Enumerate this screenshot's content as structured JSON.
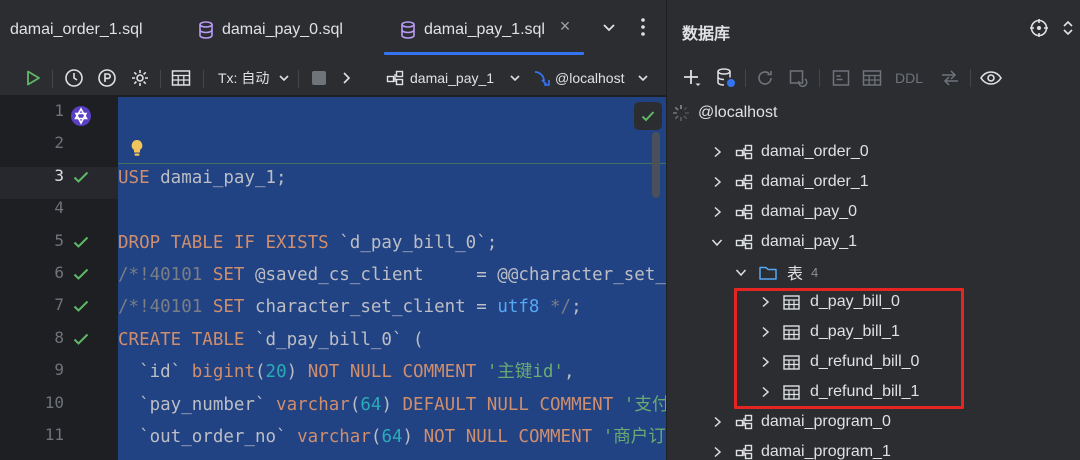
{
  "editor": {
    "tabs": [
      {
        "label": "damai_order_1.sql",
        "active": false
      },
      {
        "label": "damai_pay_0.sql",
        "active": false
      },
      {
        "label": "damai_pay_1.sql",
        "active": true
      }
    ],
    "toolbar": {
      "tx_label": "Tx: 自动",
      "schema_label": "damai_pay_1",
      "host_label": "@localhost"
    },
    "line_numbers": [
      "1",
      "2",
      "3",
      "4",
      "5",
      "6",
      "7",
      "8",
      "9",
      "10",
      "11"
    ],
    "lines": [
      {
        "n": 1,
        "parts": []
      },
      {
        "n": 2,
        "parts": []
      },
      {
        "n": 3,
        "parts": [
          [
            "kw",
            "USE"
          ],
          [
            "plain",
            " damai_pay_1;"
          ]
        ]
      },
      {
        "n": 4,
        "parts": []
      },
      {
        "n": 5,
        "parts": [
          [
            "kw",
            "DROP TABLE IF EXISTS"
          ],
          [
            "plain",
            " `d_pay_bill_0`;"
          ]
        ]
      },
      {
        "n": 6,
        "parts": [
          [
            "cmt",
            "/*!40101 "
          ],
          [
            "kw",
            "SET"
          ],
          [
            "plain",
            " @saved_cs_client     = @@character_set_client */;"
          ]
        ]
      },
      {
        "n": 7,
        "parts": [
          [
            "cmt",
            "/*!40101 "
          ],
          [
            "kw",
            "SET"
          ],
          [
            "plain",
            " character_set_client = "
          ],
          [
            "fn",
            "utf8"
          ],
          [
            "cmt",
            " */"
          ],
          [
            "plain",
            ";"
          ]
        ]
      },
      {
        "n": 8,
        "parts": [
          [
            "kw",
            "CREATE TABLE"
          ],
          [
            "plain",
            " `d_pay_bill_0` ("
          ]
        ]
      },
      {
        "n": 9,
        "parts": [
          [
            "plain",
            "  `id` "
          ],
          [
            "kw",
            "bigint"
          ],
          [
            "plain",
            "("
          ],
          [
            "num",
            "20"
          ],
          [
            "plain",
            ") "
          ],
          [
            "kw",
            "NOT NULL COMMENT"
          ],
          [
            "plain",
            " "
          ],
          [
            "str",
            "'主键id'"
          ],
          [
            "plain",
            ","
          ]
        ]
      },
      {
        "n": 10,
        "parts": [
          [
            "plain",
            "  `pay_number` "
          ],
          [
            "kw",
            "varchar"
          ],
          [
            "plain",
            "("
          ],
          [
            "num",
            "64"
          ],
          [
            "plain",
            ") "
          ],
          [
            "kw",
            "DEFAULT NULL COMMENT"
          ],
          [
            "plain",
            " "
          ],
          [
            "str",
            "'支付单号'"
          ]
        ]
      },
      {
        "n": 11,
        "parts": [
          [
            "plain",
            "  `out_order_no` "
          ],
          [
            "kw",
            "varchar"
          ],
          [
            "plain",
            "("
          ],
          [
            "num",
            "64"
          ],
          [
            "plain",
            ") "
          ],
          [
            "kw",
            "NOT NULL COMMENT"
          ],
          [
            "plain",
            " "
          ],
          [
            "str",
            "'商户订单号'"
          ]
        ]
      }
    ]
  },
  "db_panel": {
    "title": "数据库",
    "ddl_label": "DDL",
    "host": "@localhost",
    "tree": [
      {
        "label": "damai_order_0",
        "type": "schema",
        "expanded": false
      },
      {
        "label": "damai_order_1",
        "type": "schema",
        "expanded": false
      },
      {
        "label": "damai_pay_0",
        "type": "schema",
        "expanded": false
      },
      {
        "label": "damai_pay_1",
        "type": "schema",
        "expanded": true
      },
      {
        "label": "表",
        "type": "folder",
        "count": "4",
        "expanded": true
      },
      {
        "label": "d_pay_bill_0",
        "type": "table",
        "expanded": false
      },
      {
        "label": "d_pay_bill_1",
        "type": "table",
        "expanded": false
      },
      {
        "label": "d_refund_bill_0",
        "type": "table",
        "expanded": false
      },
      {
        "label": "d_refund_bill_1",
        "type": "table",
        "expanded": false
      },
      {
        "label": "damai_program_0",
        "type": "schema",
        "expanded": false
      },
      {
        "label": "damai_program_1",
        "type": "schema",
        "expanded": false
      }
    ]
  },
  "colors": {
    "selection": "#214283",
    "accent": "#3574f0",
    "check": "#5fb865",
    "highlight": "#e52521"
  }
}
